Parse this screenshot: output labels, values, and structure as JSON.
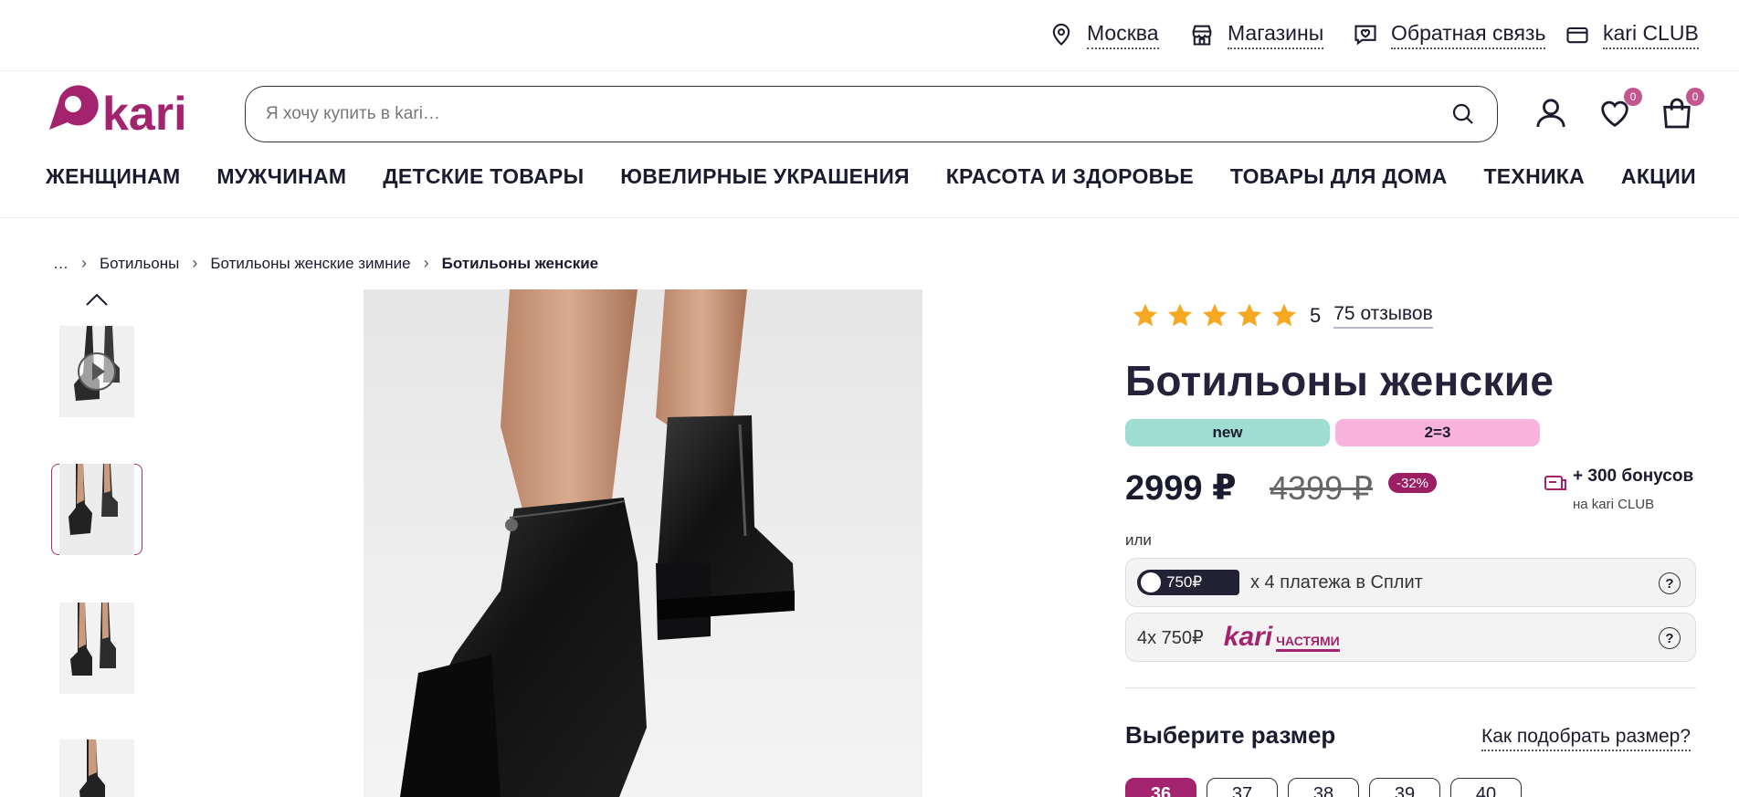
{
  "topbar": {
    "city": "Москва",
    "stores": "Магазины",
    "feedback": "Обратная связь",
    "club": "kari CLUB"
  },
  "header": {
    "logo_text": "kari",
    "search_placeholder": "Я хочу купить в kari…",
    "favorites_count": "0",
    "cart_count": "0"
  },
  "nav": {
    "items": [
      "ЖЕНЩИНАМ",
      "МУЖЧИНАМ",
      "ДЕТСКИЕ ТОВАРЫ",
      "ЮВЕЛИРНЫЕ УКРАШЕНИЯ",
      "КРАСОТА И ЗДОРОВЬЕ",
      "ТОВАРЫ ДЛЯ ДОМА",
      "ТЕХНИКА",
      "АКЦИИ"
    ]
  },
  "breadcrumbs": {
    "ellipsis": "…",
    "items": [
      "Ботильоны",
      "Ботильоны женские зимние"
    ],
    "current": "Ботильоны женские"
  },
  "product": {
    "rating_value": 5,
    "rating_text": "5",
    "reviews": "75 отзывов",
    "title": "Ботильоны женские",
    "tags": [
      {
        "label": "new",
        "color": "#9fdcd2"
      },
      {
        "label": "2=3",
        "color": "#f9b3dc"
      }
    ],
    "price": "2999 ₽",
    "old_price": "4399 ₽",
    "discount": "-32%",
    "bonus": "+ 300 бонусов",
    "bonus_sub": "на kari CLUB",
    "or": "или",
    "split_amount": "750₽",
    "split_text": "х 4 платежа в Сплит",
    "parts_text": "4х 750₽",
    "parts_brand": "kari",
    "parts_brand_sub": "ЧАСТЯМИ",
    "help_icon": "?",
    "size_title": "Выберите размер",
    "size_link": "Как подобрать размер?",
    "sizes": [
      "36",
      "37",
      "38",
      "39",
      "40"
    ],
    "selected_size": "36"
  },
  "colors": {
    "brand": "#a4236e",
    "star": "#f7a823",
    "discount_bg": "#9b1f62"
  }
}
